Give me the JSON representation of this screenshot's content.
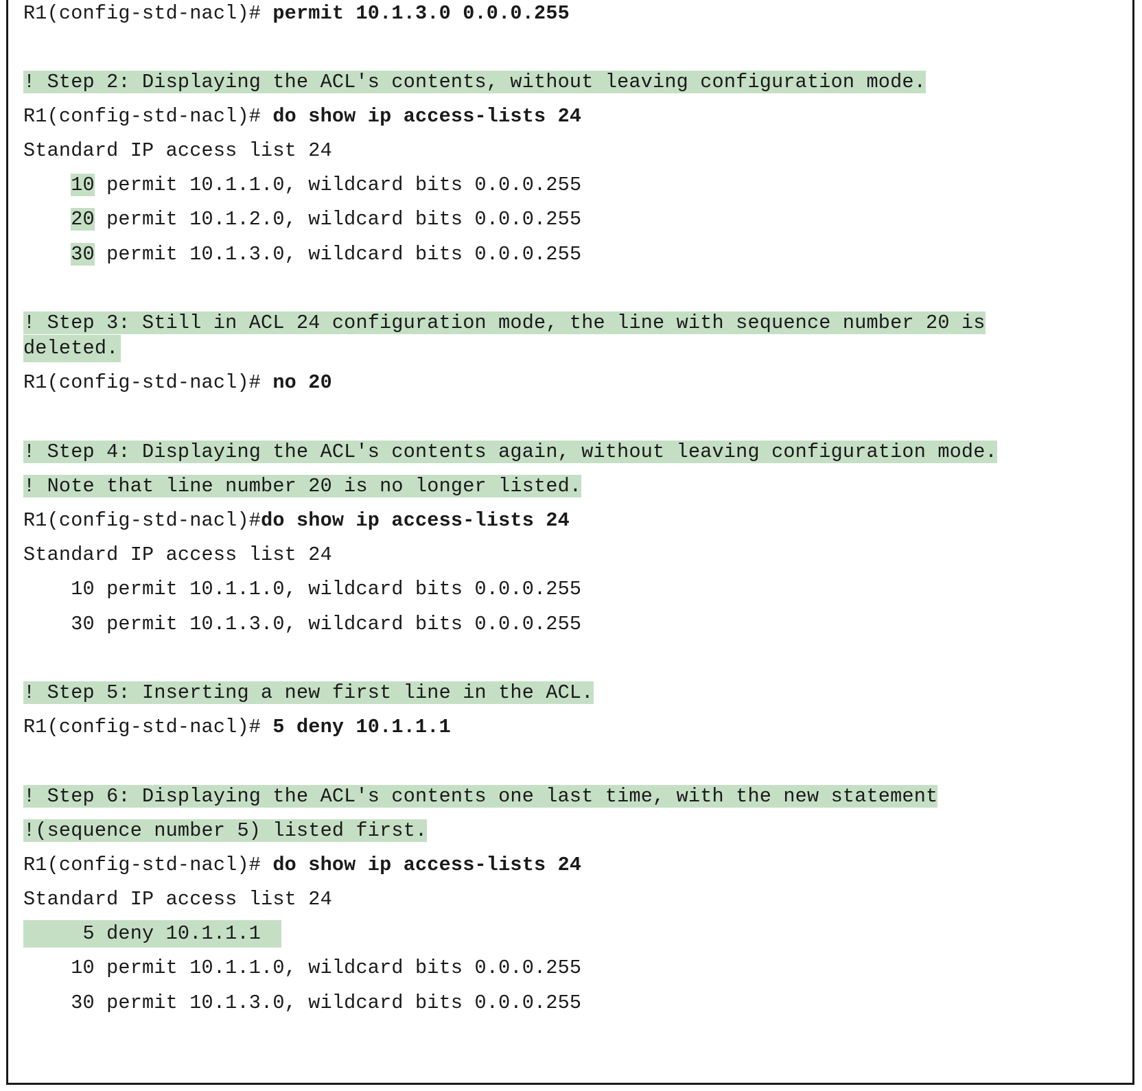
{
  "lines": {
    "l01_prompt": "R1(config-std-nacl)# ",
    "l01_cmd": "permit 10.1.3.0 0.0.0.255",
    "l02_comment": "! Step 2: Displaying the ACL's contents, without leaving configuration mode.",
    "l03_prompt": "R1(config-std-nacl)# ",
    "l03_cmd": "do show ip access-lists 24",
    "l04_out": "Standard IP access list 24",
    "l05_seq": "10",
    "l05_rest": " permit 10.1.1.0, wildcard bits 0.0.0.255",
    "l06_seq": "20",
    "l06_rest": " permit 10.1.2.0, wildcard bits 0.0.0.255",
    "l07_seq": "30",
    "l07_rest": " permit 10.1.3.0, wildcard bits 0.0.0.255",
    "l08_comment_a": "! Step 3: Still in ACL 24 configuration mode, the line with sequence number 20 is",
    "l08_comment_b": "deleted.",
    "l09_prompt": "R1(config-std-nacl)# ",
    "l09_cmd": "no 20",
    "l10_comment": "! Step 4: Displaying the ACL's contents again, without leaving configuration mode.",
    "l11_comment": "! Note that line number 20 is no longer listed.",
    "l12_prompt": "R1(config-std-nacl)#",
    "l12_cmd": "do show ip access-lists 24",
    "l13_out": "Standard IP access list 24",
    "l14_out": "    10 permit 10.1.1.0, wildcard bits 0.0.0.255",
    "l15_out": "    30 permit 10.1.3.0, wildcard bits 0.0.0.255",
    "l16_comment": "! Step 5: Inserting a new first line in the ACL.",
    "l17_prompt": "R1(config-std-nacl)# ",
    "l17_cmd": "5 deny 10.1.1.1",
    "l18_comment": "! Step 6: Displaying the ACL's contents one last time, with the new statement",
    "l19_comment": "!(sequence number 5) listed first.",
    "l20_prompt": "R1(config-std-nacl)# ",
    "l20_cmd": "do show ip access-lists 24",
    "l21_out": "Standard IP access list 24",
    "l22_out": "     5 deny 10.1.1.1",
    "l23_out": "    10 permit 10.1.1.0, wildcard bits 0.0.0.255",
    "l24_out": "    30 permit 10.1.3.0, wildcard bits 0.0.0.255"
  },
  "colors": {
    "highlight": "#c5dfc5",
    "text": "#1a1a1a",
    "border": "#1a1a1a"
  }
}
